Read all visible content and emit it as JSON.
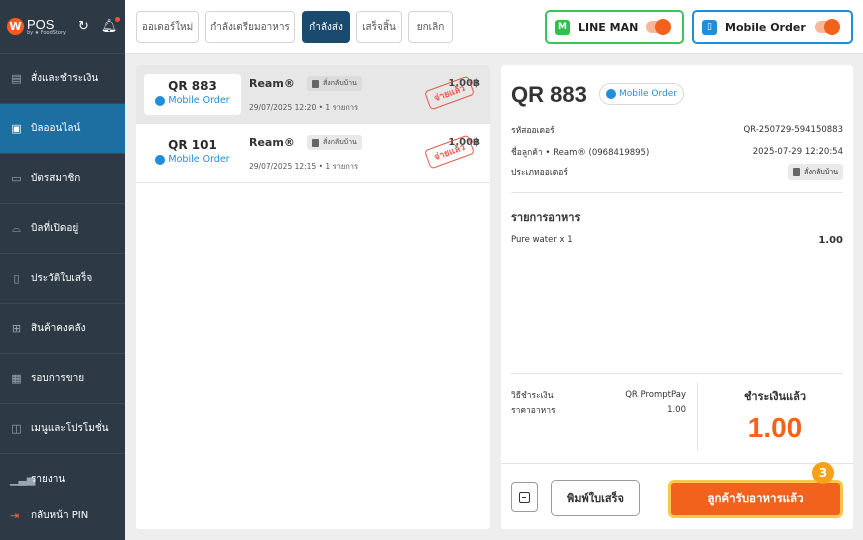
{
  "app": {
    "logo_letter": "W",
    "name": "POS",
    "byline": "by ★ FoodStory"
  },
  "sidebar": {
    "items": [
      {
        "label": "สั่งและชำระเงิน",
        "icon": "order-pay-icon",
        "active": false
      },
      {
        "label": "บิลออนไลน์",
        "icon": "online-bill-icon",
        "active": true
      },
      {
        "label": "บัตรสมาชิก",
        "icon": "member-card-icon",
        "active": false
      },
      {
        "label": "บิลที่เปิดอยู่",
        "icon": "open-bill-icon",
        "active": false
      },
      {
        "label": "ประวัติใบเสร็จ",
        "icon": "receipt-history-icon",
        "active": false
      },
      {
        "label": "สินค้าคงคลัง",
        "icon": "inventory-icon",
        "active": false
      },
      {
        "label": "รอบการขาย",
        "icon": "sales-round-icon",
        "active": false
      },
      {
        "label": "เมนูและโปรโมชั่น",
        "icon": "menu-promo-icon",
        "active": false
      }
    ],
    "report": "รายงาน",
    "back_pin": "กลับหน้า PIN"
  },
  "tabs": [
    {
      "label": "ออเดอร์ใหม่",
      "active": false
    },
    {
      "label": "กำลังเตรียมอาหาร",
      "active": false
    },
    {
      "label": "กำลังส่ง",
      "active": true
    },
    {
      "label": "เสร็จสิ้น",
      "active": false
    },
    {
      "label": "ยกเลิก",
      "active": false
    }
  ],
  "channels": {
    "lineman": {
      "label": "LINE MAN",
      "badge": "M",
      "enabled": true
    },
    "mobile": {
      "label": "Mobile Order",
      "enabled": true
    }
  },
  "orders": [
    {
      "code": "QR 883",
      "source": "Mobile Order",
      "customer": "Ream®",
      "type": "สั่งกลับบ้าน",
      "meta": "29/07/2025 12:20 • 1 รายการ",
      "amount": "1.00฿",
      "stamp": "จ่ายแล้ว",
      "selected": true
    },
    {
      "code": "QR 101",
      "source": "Mobile Order",
      "customer": "Ream®",
      "type": "สั่งกลับบ้าน",
      "meta": "29/07/2025 12:15 • 1 รายการ",
      "amount": "1.00฿",
      "stamp": "จ่ายแล้ว",
      "selected": false
    }
  ],
  "detail": {
    "title": "QR 883",
    "source": "Mobile Order",
    "order_no_label": "รหัสออเดอร์",
    "order_no": "QR-250729-594150883",
    "customer_label": "ชื่อลูกค้า • Ream® (0968419895)",
    "datetime": "2025-07-29 12:20:54",
    "type_label": "ประเภทออเดอร์",
    "type_value": "สั่งกลับบ้าน",
    "items_title": "รายการอาหาร",
    "items": [
      {
        "name": "Pure water x 1",
        "price": "1.00"
      }
    ],
    "payment_method_label": "วิธีชำระเงิน",
    "payment_method": "QR PromptPay",
    "food_price_label": "ราคาอาหาร",
    "food_price": "1.00",
    "paid_label": "ชำระเงินแล้ว",
    "paid_amount": "1.00",
    "print_button": "พิมพ์ใบเสร็จ",
    "received_button": "ลูกค้ารับอาหารแล้ว",
    "step": "3"
  },
  "colors": {
    "accent": "#f2621d",
    "sidebar": "#2d3a46",
    "active_nav": "#1c6fa0",
    "active_tab": "#1a4b6e",
    "mobile_blue": "#1e8fd8",
    "line_green": "#2fbf4f"
  }
}
